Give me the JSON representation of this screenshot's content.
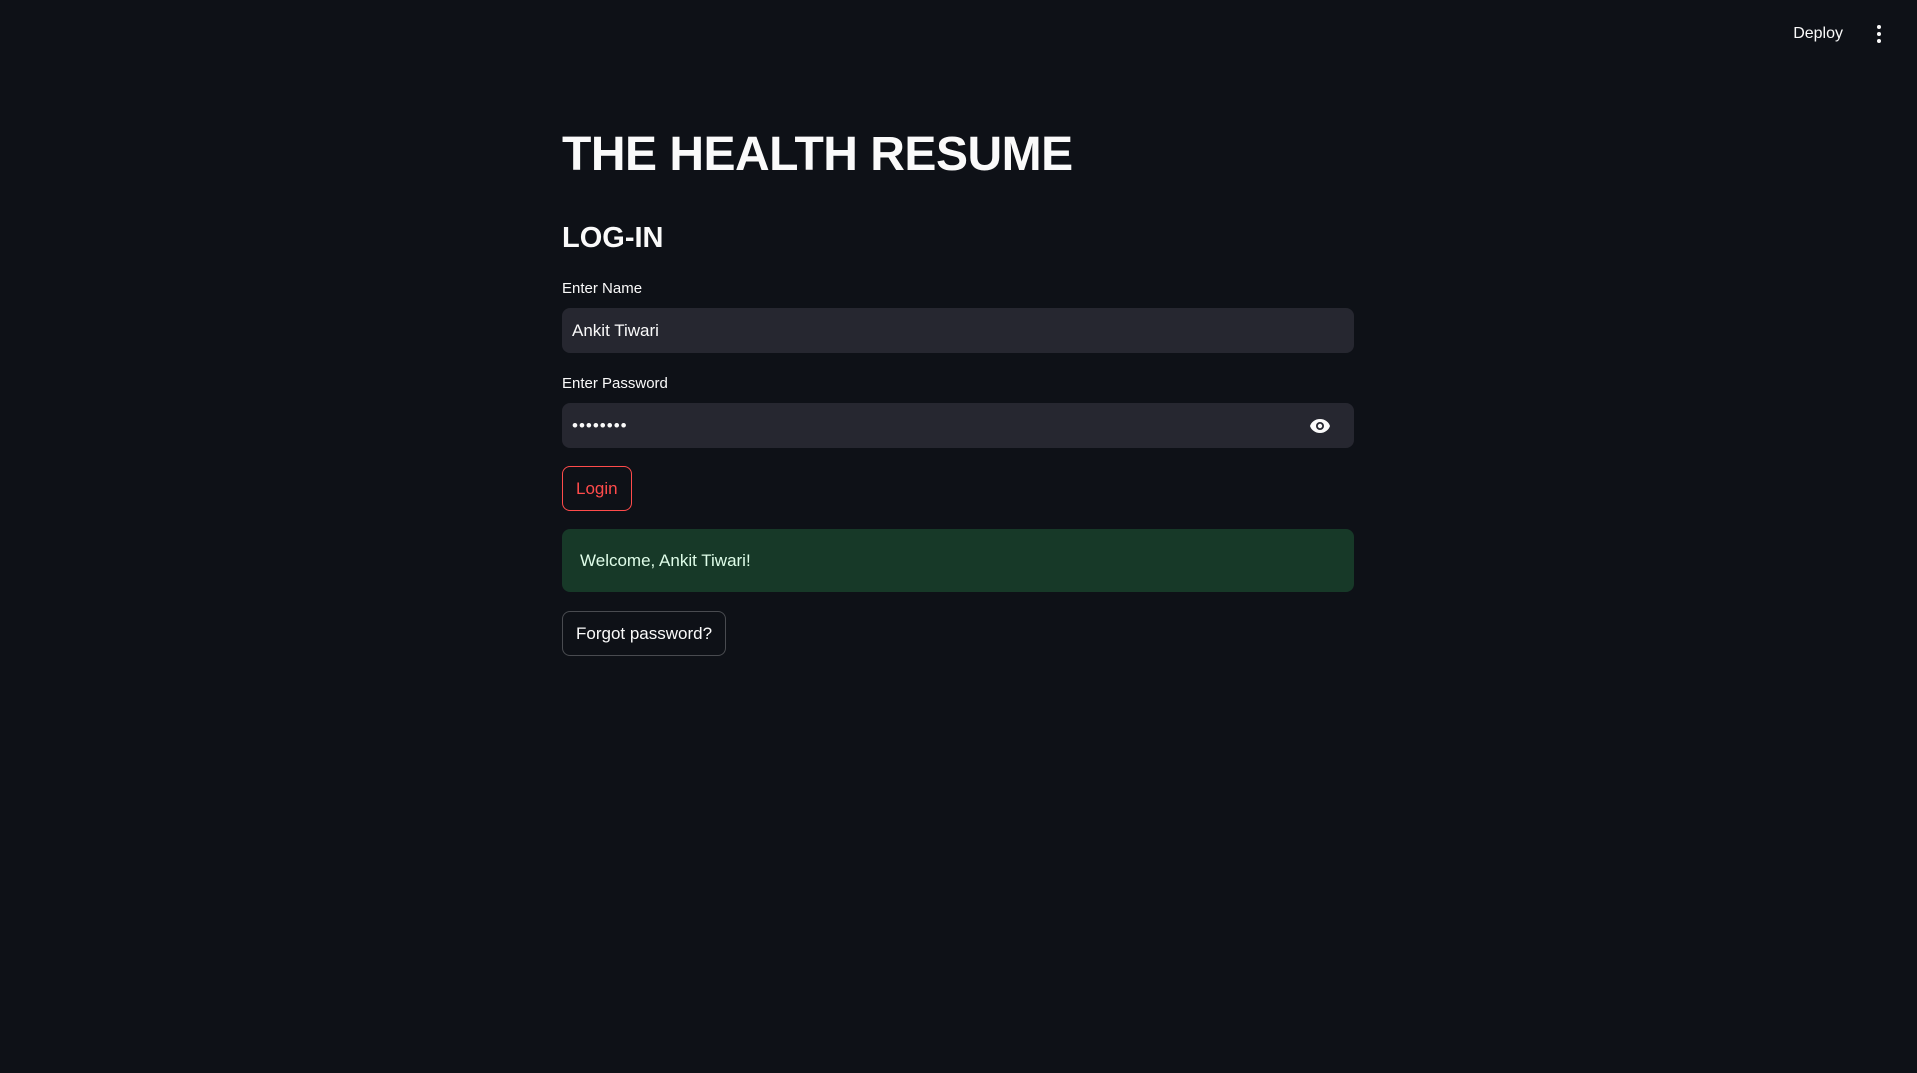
{
  "toolbar": {
    "deploy_label": "Deploy",
    "menu_icon": "vertical-ellipsis-icon"
  },
  "main": {
    "title": "THE HEALTH RESUME",
    "section_title": "LOG-IN",
    "name_field": {
      "label": "Enter Name",
      "value": "Ankit Tiwari"
    },
    "password_field": {
      "label": "Enter Password",
      "value": "••••••••",
      "toggle_icon": "eye-icon"
    },
    "login_button": "Login",
    "success_message": "Welcome, Ankit Tiwari!",
    "forgot_button": "Forgot password?"
  },
  "colors": {
    "background": "#0e1117",
    "input_background": "#262730",
    "primary": "#ff4b4b",
    "success_background": "#173928",
    "success_text": "#dffde9"
  }
}
